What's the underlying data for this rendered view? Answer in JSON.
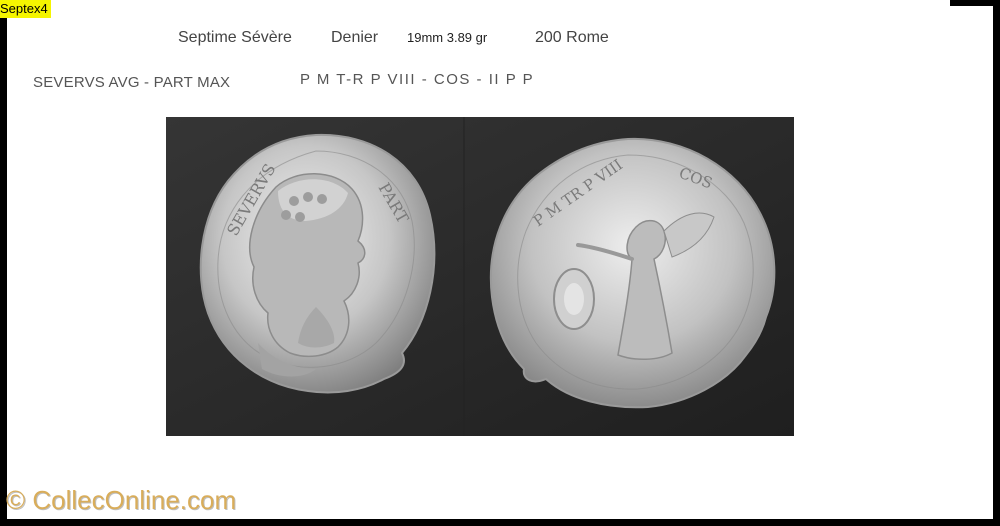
{
  "label_tag": "Septex4",
  "header": {
    "title": "Septime Sévère",
    "denomination": "Denier",
    "size_weight": "19mm 3.89 gr",
    "date_mint": "200 Rome"
  },
  "legends": {
    "obverse": "SEVERVS AVG - PART MAX",
    "reverse": "P M T-R P VIII - COS - II P P"
  },
  "watermark": "© CollecOnline.com",
  "colors": {
    "background": "#ffffff",
    "tag": "#f5f500",
    "watermark": "#d9ad5a",
    "photo_background": "#2a2a2a",
    "silver": "#c9c9c9"
  }
}
